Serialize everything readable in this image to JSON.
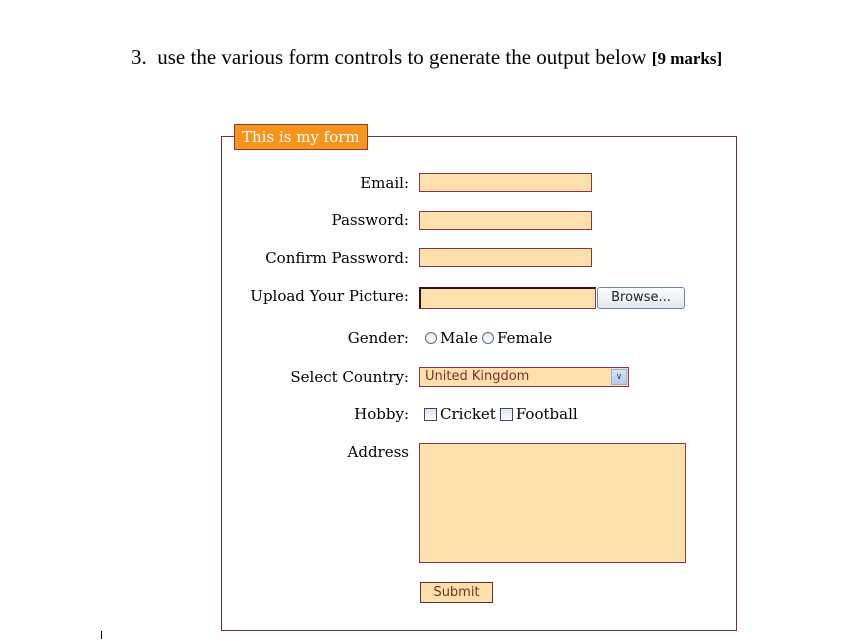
{
  "question": {
    "number": "3.",
    "text": "use the various form controls to generate the output below",
    "marks": "[9 marks]"
  },
  "form": {
    "legend": "This is my form",
    "email": {
      "label": "Email:",
      "value": ""
    },
    "password": {
      "label": "Password:",
      "value": ""
    },
    "confirm_password": {
      "label": "Confirm Password:",
      "value": ""
    },
    "upload": {
      "label": "Upload Your Picture:",
      "value": "",
      "browse_label": "Browse..."
    },
    "gender": {
      "label": "Gender:",
      "options": [
        "Male",
        "Female"
      ]
    },
    "country": {
      "label": "Select Country:",
      "selected": "United Kingdom",
      "arrow": "⌄"
    },
    "hobby": {
      "label": "Hobby:",
      "options": [
        "Cricket",
        "Football"
      ]
    },
    "address": {
      "label": "Address",
      "value": ""
    },
    "submit_label": "Submit"
  },
  "colors": {
    "legend_bg": "#f7941d",
    "field_bg": "#fde0ac",
    "field_border": "#8a3348",
    "fieldset_border": "#7a2a4a"
  }
}
